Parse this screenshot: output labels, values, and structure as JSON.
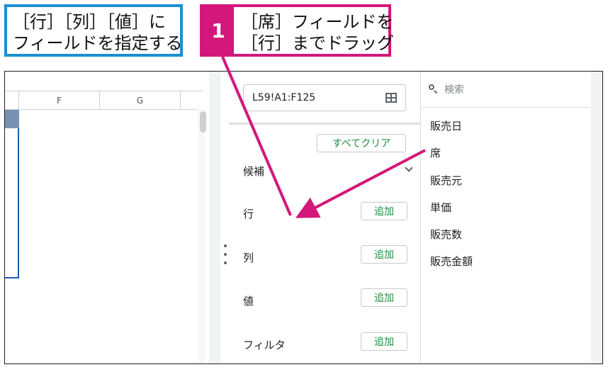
{
  "callouts": {
    "instruction_line1": "［行］［列］［値］に",
    "instruction_line2": "フィールドを指定する",
    "step_number": "1",
    "step_line1": "［席］フィールドを",
    "step_line2": "［行］までドラッグ"
  },
  "sheet": {
    "columns": [
      "F",
      "G"
    ]
  },
  "pivot_editor": {
    "range": "L59!A1:F125",
    "clear_all_label": "すべてクリア",
    "suggestions_label": "候補",
    "sections": [
      {
        "label": "行",
        "add_label": "追加"
      },
      {
        "label": "列",
        "add_label": "追加"
      },
      {
        "label": "値",
        "add_label": "追加"
      },
      {
        "label": "フィルタ",
        "add_label": "追加"
      }
    ]
  },
  "field_list": {
    "search_placeholder": "検索",
    "fields": [
      "販売日",
      "席",
      "販売元",
      "単価",
      "販売数",
      "販売金額"
    ]
  },
  "colors": {
    "blue_callout": "#1b8fd0",
    "pink_callout": "#d4177a",
    "add_button_text": "#1e8e3e",
    "selection": "#1a5fb4"
  },
  "icons": [
    "search-icon",
    "grid-icon",
    "chevron-down-icon",
    "drag-handle-icon"
  ]
}
